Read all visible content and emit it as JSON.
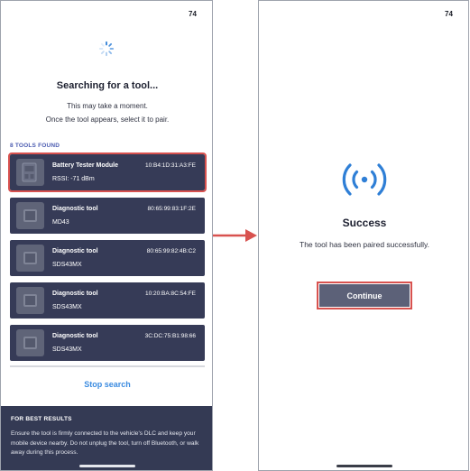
{
  "left_screen": {
    "status_time": "74",
    "title": "Searching for a tool...",
    "subtitle_line1": "This may take a moment.",
    "subtitle_line2": "Once the tool appears, select it to pair.",
    "tools_found_label": "8 TOOLS FOUND",
    "tools": [
      {
        "name": "Battery Tester Module",
        "mac": "10:B4:1D:31:A3:FE",
        "detail": "RSSI: -71 dBm",
        "selected": true
      },
      {
        "name": "Diagnostic tool",
        "mac": "80:65:99:83:1F:2E",
        "detail": "MD43",
        "selected": false
      },
      {
        "name": "Diagnostic tool",
        "mac": "80:65:99:82:4B:C2",
        "detail": "SDS43MX",
        "selected": false
      },
      {
        "name": "Diagnostic tool",
        "mac": "10:20:BA:8C:54:FE",
        "detail": "SDS43MX",
        "selected": false
      },
      {
        "name": "Diagnostic tool",
        "mac": "3C:DC:75:B1:98:66",
        "detail": "SDS43MX",
        "selected": false
      }
    ],
    "stop_search_label": "Stop search",
    "best_results": {
      "title": "FOR BEST RESULTS",
      "text": "Ensure the tool is firmly connected to the vehicle's DLC and keep your mobile device nearby. Do not unplug the tool, turn off Bluetooth, or walk away during this process."
    }
  },
  "right_screen": {
    "status_time": "74",
    "icon": "wireless-signal-icon",
    "title": "Success",
    "message": "The tool has been paired successfully.",
    "continue_label": "Continue"
  },
  "colors": {
    "card_background": "#363b57",
    "accent_blue": "#3b8be0",
    "highlight_red": "#d8524f",
    "panel_background": "#343a54",
    "button_background": "#5c6178"
  }
}
